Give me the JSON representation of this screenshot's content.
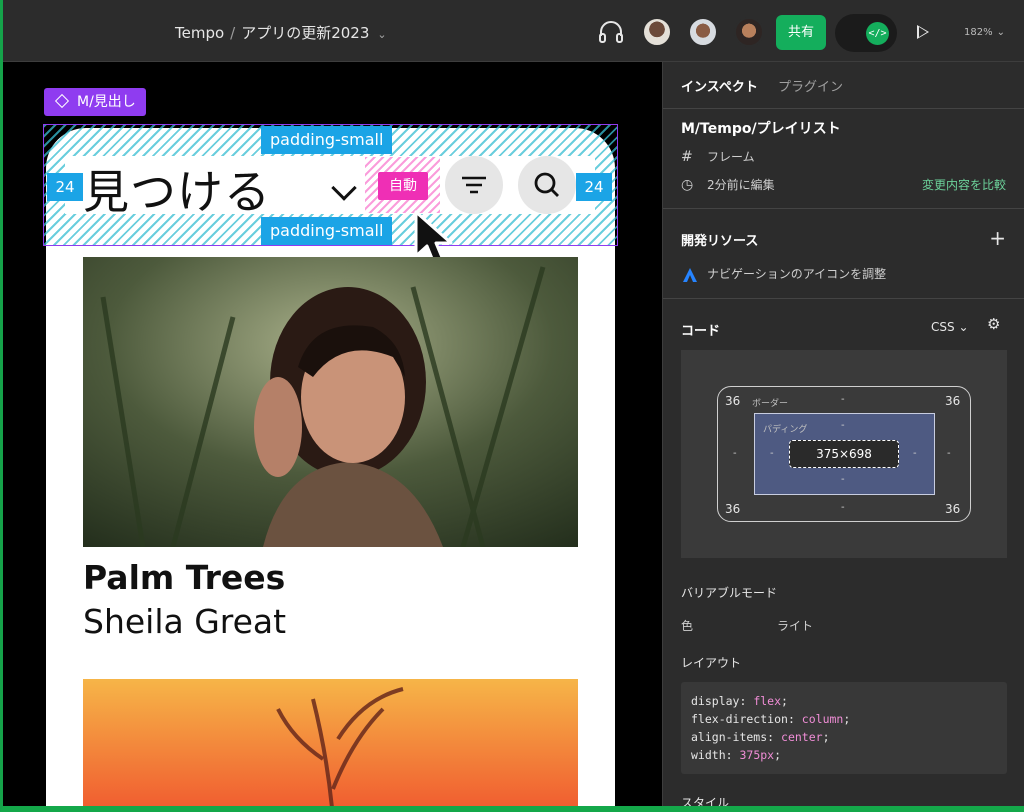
{
  "topbar": {
    "breadcrumb_project": "Tempo",
    "breadcrumb_sep": "/",
    "breadcrumb_file": "アプリの更新2023",
    "share_label": "共有",
    "dev_mode_icon": "</>",
    "zoom_level": "182%"
  },
  "canvas": {
    "component_tag": "M/見出し",
    "padding_top_label": "padding-small",
    "padding_bottom_label": "padding-small",
    "padding_left_label": "24",
    "padding_right_label": "24",
    "header_title": "見つける",
    "auto_label": "自動",
    "track_title": "Palm Trees",
    "track_artist": "Sheila Great"
  },
  "panel": {
    "tabs": [
      {
        "label": "インスペクト",
        "active": true
      },
      {
        "label": "プラグイン",
        "active": false
      }
    ],
    "selection_title": "M/Tempo/プレイリスト",
    "selection_type": "フレーム",
    "edited_time": "2分前に編集",
    "compare_label": "変更内容を比較",
    "dev_resources_heading": "開発リソース",
    "dev_resource_item": "ナビゲーションのアイコンを調整",
    "code_heading": "コード",
    "code_lang": "CSS",
    "box_model": {
      "border_label": "ボーダー",
      "padding_label": "パディング",
      "content_size": "375×698",
      "corner_tl": "36",
      "corner_tr": "36",
      "corner_bl": "36",
      "corner_br": "36",
      "dash": "-"
    },
    "variable_modes_heading": "バリアブルモード",
    "variable_color_label": "色",
    "variable_color_value": "ライト",
    "layout_heading": "レイアウト",
    "code_lines": [
      {
        "prop": "display",
        "value": "flex"
      },
      {
        "prop": "flex-direction",
        "value": "column"
      },
      {
        "prop": "align-items",
        "value": "center"
      },
      {
        "prop": "width",
        "value": "375px"
      }
    ],
    "style_heading": "スタイル"
  },
  "colors": {
    "accent_green": "#14ae5c",
    "component_purple": "#8f3cf0",
    "padding_blue": "#1ba4e6",
    "auto_pink": "#ef2fb5"
  }
}
